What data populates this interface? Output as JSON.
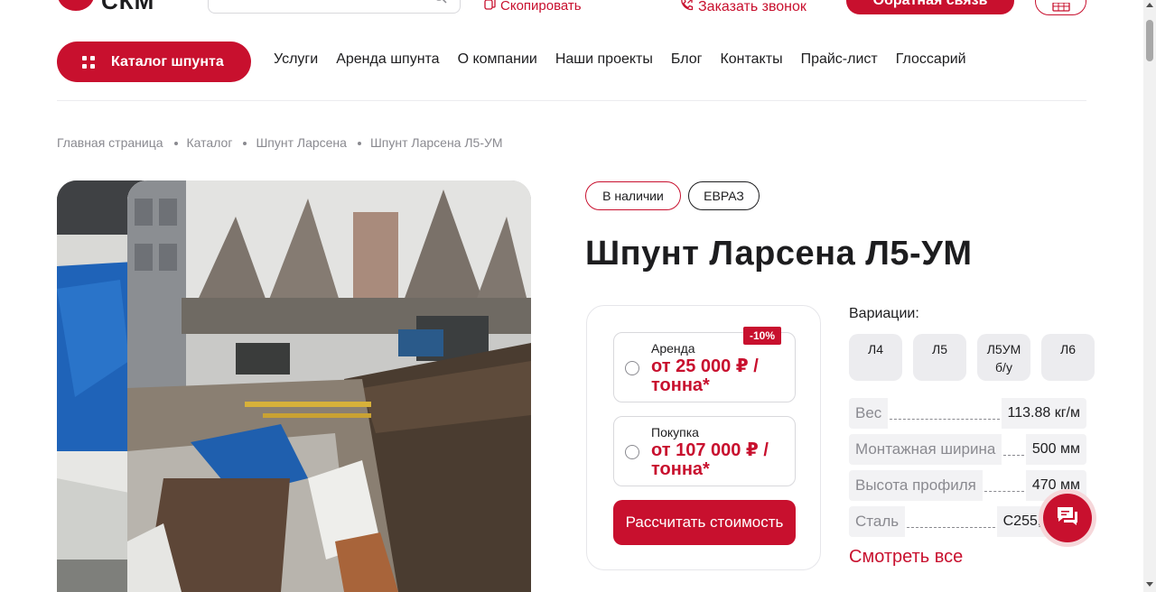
{
  "header": {
    "logo_text": "СКМ",
    "copy_label": "Скопировать",
    "call_label": "Заказать звонок",
    "feedback_label": "Обратная связь"
  },
  "nav": {
    "catalog_label": "Каталог шпунта",
    "items": [
      "Услуги",
      "Аренда шпунта",
      "О компании",
      "Наши проекты",
      "Блог",
      "Контакты",
      "Прайс-лист",
      "Глоссарий"
    ]
  },
  "breadcrumb": [
    "Главная страница",
    "Каталог",
    "Шпунт Ларсена",
    "Шпунт Ларсена Л5-УМ"
  ],
  "product": {
    "badges": [
      "В наличии",
      "ЕВРАЗ"
    ],
    "title": "Шпунт Ларсена Л5-УМ",
    "options": {
      "rent": {
        "label": "Аренда",
        "price": "от 25 000 ₽ / тонна*",
        "discount": "-10%"
      },
      "buy": {
        "label": "Покупка",
        "price": "от 107 000 ₽ / тонна*"
      }
    },
    "calc_button": "Рассчитать стоимость",
    "variations_title": "Вариации:",
    "variants": [
      "Л4",
      "Л5",
      "Л5УМ б/у",
      "Л6"
    ],
    "specs": [
      {
        "label": "Вес",
        "value": "113.88 кг/м"
      },
      {
        "label": "Монтажная ширина",
        "value": "500 мм"
      },
      {
        "label": "Высота профиля",
        "value": "470 мм"
      },
      {
        "label": "Сталь",
        "value": "С255, С345"
      }
    ],
    "see_all": "Смотреть все"
  },
  "colors": {
    "accent": "#c8102e",
    "text": "#1d1d1f",
    "muted": "#8a8a90"
  },
  "icons": [
    "search-icon",
    "copy-icon",
    "phone-icon",
    "cart-icon",
    "grid-icon",
    "chat-icon"
  ]
}
